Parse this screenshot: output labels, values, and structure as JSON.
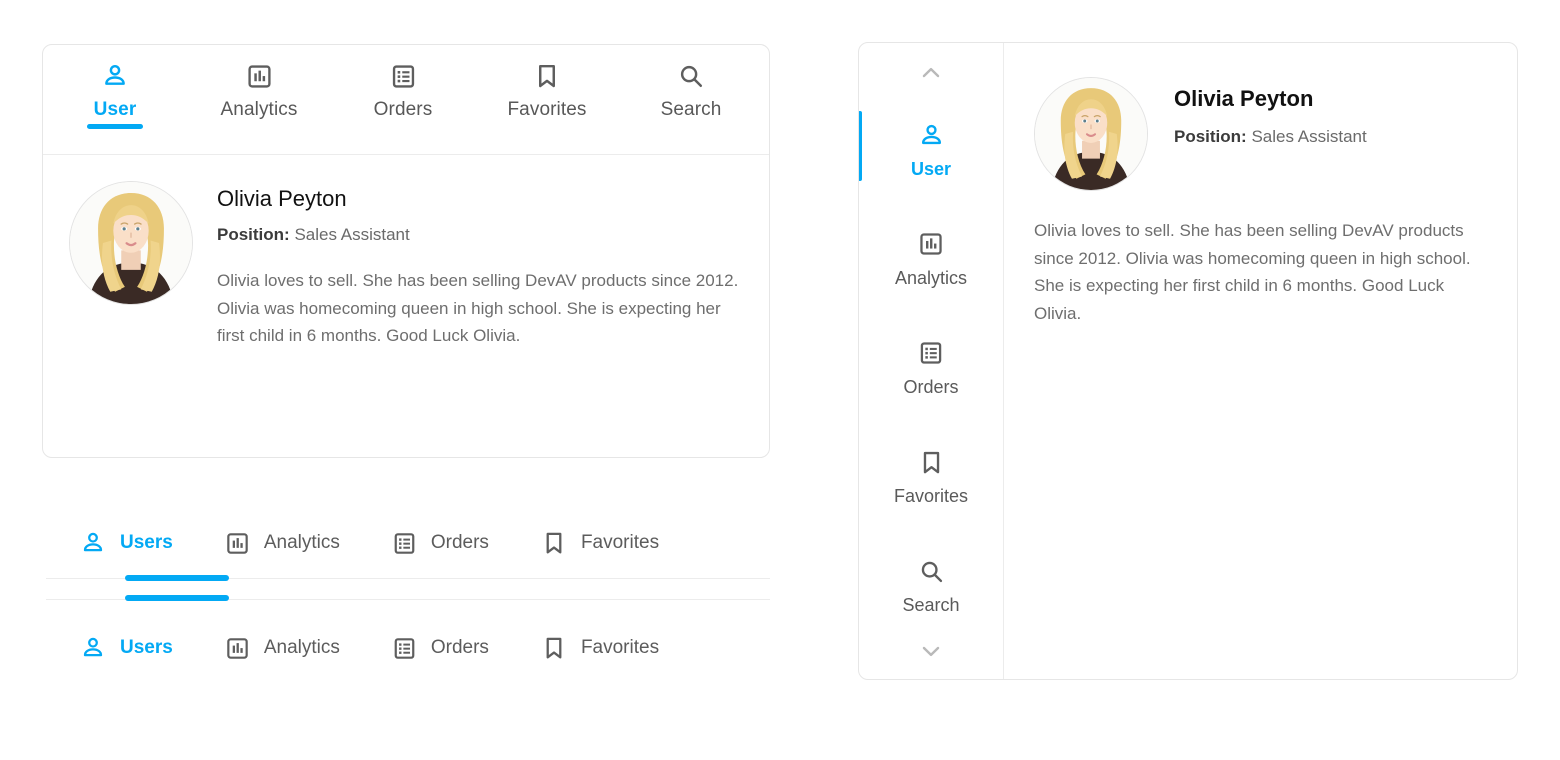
{
  "accent_color": "#03a9f4",
  "icon_color": "#5e5e5e",
  "text_color": "#6e6e6e",
  "left_card": {
    "top_tabs": [
      {
        "label": "User",
        "icon": "user-icon",
        "active": true
      },
      {
        "label": "Analytics",
        "icon": "analytics-icon",
        "active": false
      },
      {
        "label": "Orders",
        "icon": "orders-icon",
        "active": false
      },
      {
        "label": "Favorites",
        "icon": "bookmark-icon",
        "active": false
      },
      {
        "label": "Search",
        "icon": "search-icon",
        "active": false
      }
    ],
    "profile": {
      "avatar": "avatar-olivia-peyton",
      "name": "Olivia Peyton",
      "position_label": "Position:",
      "position_value": "Sales Assistant",
      "bio": "Olivia loves to sell. She has been selling DevAV products since 2012. Olivia was homecoming queen in high school. She is expecting her first child in 6 months. Good Luck Olivia."
    }
  },
  "tab_bar_1": {
    "indicator_position": "bottom",
    "tabs": [
      {
        "label": "Users",
        "icon": "user-icon",
        "active": true
      },
      {
        "label": "Analytics",
        "icon": "analytics-icon",
        "active": false
      },
      {
        "label": "Orders",
        "icon": "orders-icon",
        "active": false
      },
      {
        "label": "Favorites",
        "icon": "bookmark-icon",
        "active": false
      }
    ]
  },
  "tab_bar_2": {
    "indicator_position": "top",
    "tabs": [
      {
        "label": "Users",
        "icon": "user-icon",
        "active": true
      },
      {
        "label": "Analytics",
        "icon": "analytics-icon",
        "active": false
      },
      {
        "label": "Orders",
        "icon": "orders-icon",
        "active": false
      },
      {
        "label": "Favorites",
        "icon": "bookmark-icon",
        "active": false
      }
    ]
  },
  "right_card": {
    "scroll_up_icon": "chevron-up-icon",
    "scroll_down_icon": "chevron-down-icon",
    "side_items": [
      {
        "label": "User",
        "icon": "user-icon",
        "active": true
      },
      {
        "label": "Analytics",
        "icon": "analytics-icon",
        "active": false
      },
      {
        "label": "Orders",
        "icon": "orders-icon",
        "active": false
      },
      {
        "label": "Favorites",
        "icon": "bookmark-icon",
        "active": false
      },
      {
        "label": "Search",
        "icon": "search-icon",
        "active": false
      }
    ],
    "profile": {
      "avatar": "avatar-olivia-peyton",
      "name": "Olivia Peyton",
      "position_label": "Position:",
      "position_value": "Sales Assistant",
      "bio": "Olivia loves to sell. She has been selling DevAV products since 2012. Olivia was homecoming queen in high school. She is expecting her first child in 6 months. Good Luck Olivia."
    }
  }
}
